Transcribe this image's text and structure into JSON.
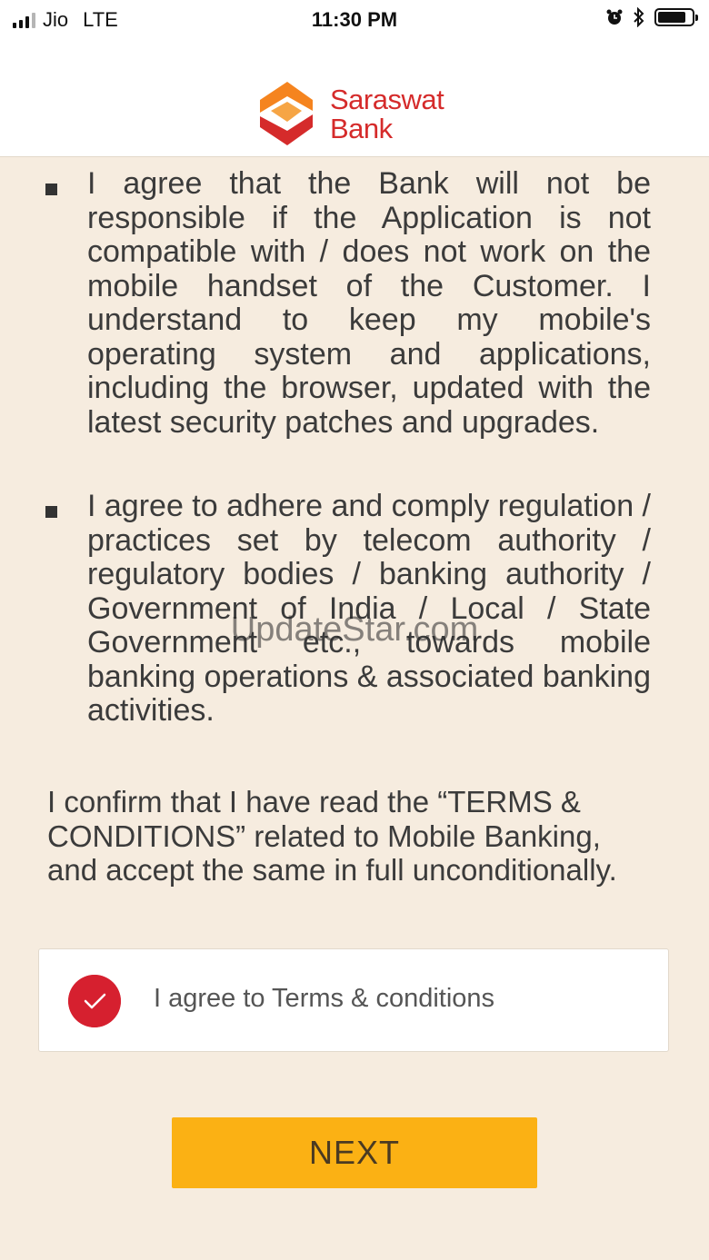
{
  "status_bar": {
    "carrier": "Jio",
    "network": "LTE",
    "time": "11:30 PM"
  },
  "header": {
    "brand_line1": "Saraswat",
    "brand_line2": "Bank"
  },
  "terms": {
    "bullets": [
      "I agree that the Bank will not be responsible if the Application is not compatible with / does not work on the mobile handset of the Customer. I understand to keep my mobile's operating system and applications, including the browser, updated with the latest security patches and upgrades.",
      "I agree to adhere and comply regulation / practices set by telecom authority / regulatory bodies / banking authority / Government of India / Local / State Government etc., towards mobile banking operations & associated banking activities."
    ],
    "confirm_text": "I confirm that I have read the “TERMS & CONDITIONS” related to Mobile Banking, and accept the same in full unconditionally."
  },
  "agree": {
    "label": "I agree to Terms & conditions",
    "checked": true
  },
  "next_label": "NEXT",
  "watermark": "UpdateStar.com",
  "colors": {
    "background": "#f6ecdf",
    "brand_red": "#d52b2b",
    "brand_orange": "#f5841f",
    "check_red": "#d6202f",
    "button": "#fbb114"
  }
}
